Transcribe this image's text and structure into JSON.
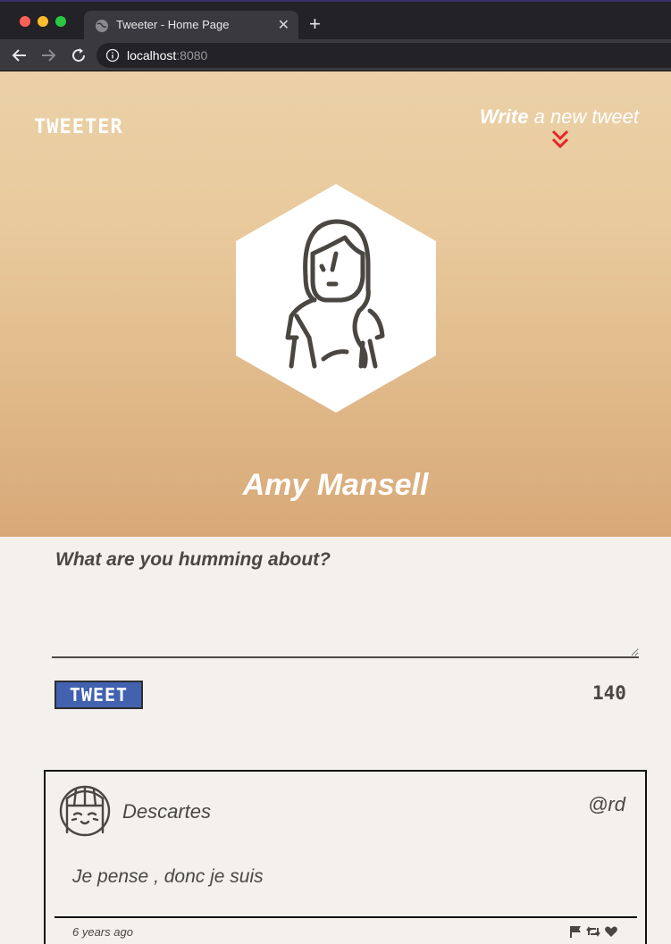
{
  "browser": {
    "tab_title": "Tweeter - Home Page",
    "url_host": "localhost",
    "url_port": ":8080"
  },
  "header": {
    "logo": "TWEETER",
    "write_bold": "Write",
    "write_rest": " a new tweet"
  },
  "profile": {
    "name": "Amy Mansell"
  },
  "compose": {
    "prompt": "What are you humming about?",
    "button_label": "TWEET",
    "counter": "140"
  },
  "tweet": {
    "author": "Descartes",
    "handle": "@rd",
    "text": "Je pense , donc je suis",
    "timestamp": "6 years ago",
    "icons": [
      "flag-icon",
      "retweet-icon",
      "heart-icon"
    ]
  },
  "colors": {
    "hero_top": "#ebd1a8",
    "hero_bottom": "#d8a978",
    "accent_red": "#e8242a",
    "tweet_button": "#4262b0",
    "text_dark": "#4a4641",
    "page_bg": "#f4f1ec"
  }
}
